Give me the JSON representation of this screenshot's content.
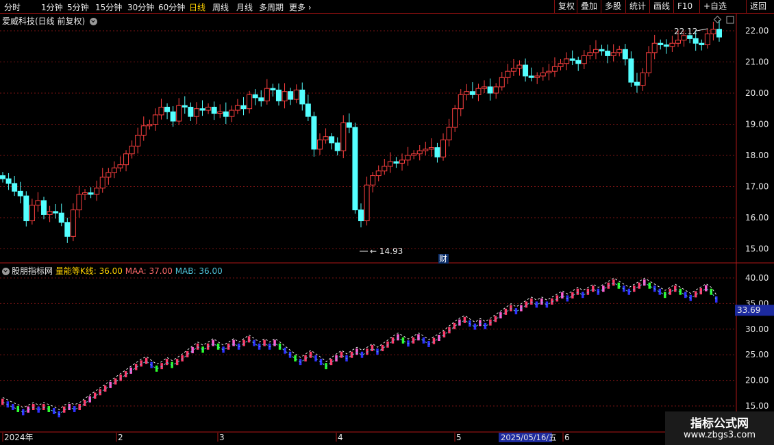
{
  "toolbar": {
    "tabs": [
      "分时",
      "1分钟",
      "5分钟",
      "15分钟",
      "30分钟",
      "60分钟",
      "日线",
      "周线",
      "月线",
      "多周期",
      "更多"
    ],
    "active_tab": "日线",
    "right_buttons": [
      "复权",
      "叠加",
      "多股",
      "统计",
      "画线",
      "F10",
      "+自选",
      "返回"
    ]
  },
  "chart_title": "爱威科技(日线 前复权)",
  "indicator": {
    "source": "股朋指标网",
    "name": "量能等K线: 36.00",
    "maa": "MAA: 37.00",
    "mab": "MAB: 36.00",
    "current": "33.69",
    "colors": {
      "name": "#ffd200",
      "maa": "#ff6a6a",
      "mab": "#4fc3d8"
    }
  },
  "price_axis": [
    "22.00",
    "21.00",
    "20.00",
    "19.00",
    "18.00",
    "17.00",
    "16.00",
    "15.00"
  ],
  "indicator_axis": [
    "40.00",
    "35.00",
    "30.00",
    "25.00",
    "20.00",
    "15.00"
  ],
  "annotations": {
    "high": "22.12",
    "low": "14.93",
    "finance_marker": "财"
  },
  "time_axis": [
    "2024年",
    "2",
    "3",
    "4",
    "5",
    "6"
  ],
  "cursor_date": "2025/05/16/五",
  "watermark": {
    "line1": "指标公式网",
    "line2": "www.zbgs3.com"
  },
  "colors": {
    "up": "#ff4040",
    "down": "#54ffff",
    "grid": "#7a1414"
  },
  "chart_data": {
    "type": "candlestick",
    "title": "爱威科技(日线 前复权)",
    "y_range": [
      14.8,
      22.5
    ],
    "closes": [
      17.25,
      17.1,
      16.85,
      16.7,
      15.9,
      16.4,
      16.55,
      16.1,
      16.2,
      16.15,
      15.85,
      15.4,
      16.25,
      16.75,
      16.8,
      16.75,
      16.95,
      17.3,
      17.45,
      17.6,
      17.7,
      18.05,
      18.3,
      18.65,
      18.95,
      19.0,
      19.3,
      19.55,
      19.4,
      19.1,
      19.6,
      19.55,
      19.25,
      19.5,
      19.45,
      19.55,
      19.35,
      19.4,
      19.25,
      19.45,
      19.6,
      19.5,
      19.95,
      19.85,
      19.75,
      20.15,
      20.1,
      19.75,
      20.05,
      19.8,
      20.1,
      19.65,
      19.25,
      18.2,
      18.5,
      18.6,
      18.4,
      18.15,
      19.05,
      18.9,
      16.25,
      15.9,
      17.05,
      17.35,
      17.5,
      17.65,
      17.8,
      17.75,
      17.85,
      18.0,
      18.05,
      18.15,
      18.2,
      18.25,
      17.95,
      18.5,
      18.9,
      19.5,
      19.95,
      20.05,
      19.95,
      20.15,
      20.2,
      20.0,
      20.2,
      20.5,
      20.7,
      20.8,
      20.9,
      20.55,
      20.5,
      20.55,
      20.65,
      20.7,
      20.85,
      20.95,
      21.1,
      21.05,
      20.95,
      21.2,
      21.3,
      21.4,
      21.35,
      21.2,
      21.3,
      21.4,
      21.1,
      20.35,
      20.25,
      20.65,
      21.3,
      21.6,
      21.55,
      21.5,
      21.6,
      21.7,
      21.85,
      21.75,
      21.6,
      21.55,
      21.9,
      22.05,
      21.8
    ]
  },
  "indicator_data": {
    "type": "line",
    "values": [
      16.0,
      15.5,
      15.0,
      14.6,
      14.0,
      14.5,
      15.0,
      14.5,
      15.0,
      14.6,
      14.2,
      13.6,
      14.5,
      15.0,
      14.6,
      15.0,
      15.8,
      16.5,
      17.2,
      17.9,
      18.6,
      19.3,
      20.0,
      20.7,
      21.4,
      22.1,
      22.8,
      23.5,
      24.0,
      23.2,
      22.5,
      23.0,
      23.8,
      23.2,
      23.8,
      24.5,
      25.3,
      26.1,
      26.8,
      26.2,
      26.8,
      27.5,
      26.8,
      26.2,
      26.8,
      27.5,
      26.8,
      27.5,
      28.2,
      27.5,
      26.8,
      27.5,
      26.8,
      27.5,
      26.8,
      26.0,
      25.2,
      24.5,
      23.8,
      24.5,
      25.2,
      24.5,
      23.8,
      23.0,
      23.8,
      24.5,
      25.2,
      24.5,
      25.2,
      25.8,
      25.2,
      25.8,
      26.5,
      25.8,
      26.5,
      27.2,
      28.0,
      28.6,
      28.0,
      27.4,
      28.0,
      28.6,
      28.0,
      27.3,
      27.9,
      28.5,
      29.2,
      30.0,
      30.8,
      31.5,
      32.0,
      31.3,
      30.7,
      31.4,
      30.8,
      31.5,
      32.2,
      32.9,
      33.6,
      34.3,
      33.7,
      34.3,
      35.0,
      35.6,
      35.0,
      35.6,
      35.0,
      35.6,
      36.2,
      36.8,
      36.2,
      36.8,
      37.5,
      36.9,
      37.5,
      38.1,
      37.5,
      38.1,
      38.7,
      39.3,
      38.7,
      38.1,
      37.5,
      38.1,
      38.7,
      39.3,
      38.7,
      38.1,
      37.5,
      36.9,
      37.5,
      38.1,
      37.5,
      36.9,
      36.3,
      37.0,
      37.6,
      38.2,
      37.5,
      36.0
    ]
  }
}
